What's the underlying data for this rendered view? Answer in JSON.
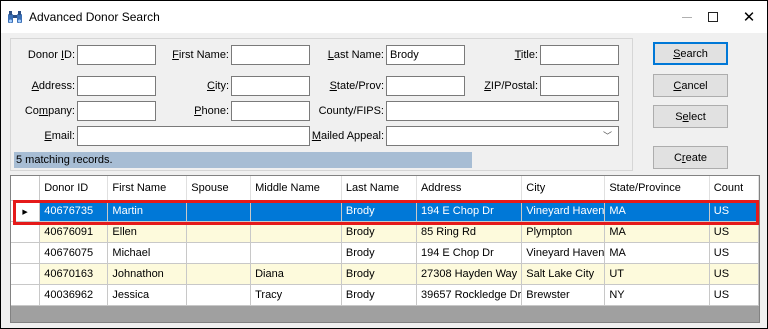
{
  "window": {
    "title": "Advanced Donor Search"
  },
  "form": {
    "donor_id_label": "Donor ID:",
    "first_name_label": "First Name:",
    "last_name_label": "Last Name:",
    "last_name_value": "Brody",
    "title_label": "Title:",
    "address_label": "Address:",
    "city_label": "City:",
    "state_label": "State/Prov:",
    "zip_label": "ZIP/Postal:",
    "company_label": "Company:",
    "phone_label": "Phone:",
    "county_label": "County/FIPS:",
    "email_label": "Email:",
    "mailed_appeal_label": "Mailed Appeal:"
  },
  "status": {
    "text": "5 matching records."
  },
  "buttons": {
    "search": "Search",
    "cancel": "Cancel",
    "select": "Select",
    "create": "Create"
  },
  "grid": {
    "columns": [
      "Donor ID",
      "First Name",
      "Spouse",
      "Middle Name",
      "Last Name",
      "Address",
      "City",
      "State/Province",
      "Count"
    ],
    "rows": [
      [
        "40676735",
        "Martin",
        "",
        "",
        "Brody",
        "194 E Chop Dr",
        "Vineyard Haven",
        "MA",
        "US"
      ],
      [
        "40676091",
        "Ellen",
        "",
        "",
        "Brody",
        "85 Ring Rd",
        "Plympton",
        "MA",
        "US"
      ],
      [
        "40676075",
        "Michael",
        "",
        "",
        "Brody",
        "194 E Chop Dr",
        "Vineyard Haven",
        "MA",
        "US"
      ],
      [
        "40670163",
        "Johnathon",
        "",
        "Diana",
        "Brody",
        "27308 Hayden Way",
        "Salt Lake City",
        "UT",
        "US"
      ],
      [
        "40036962",
        "Jessica",
        "",
        "Tracy",
        "Brody",
        "39657 Rockledge Dr",
        "Brewster",
        "NY",
        "US"
      ]
    ],
    "selected_row": 0
  },
  "colors": {
    "selection": "#0078d7",
    "highlight": "#e51a1a",
    "alt_row": "#fdfadc",
    "status_bar": "#a7bdd4"
  }
}
